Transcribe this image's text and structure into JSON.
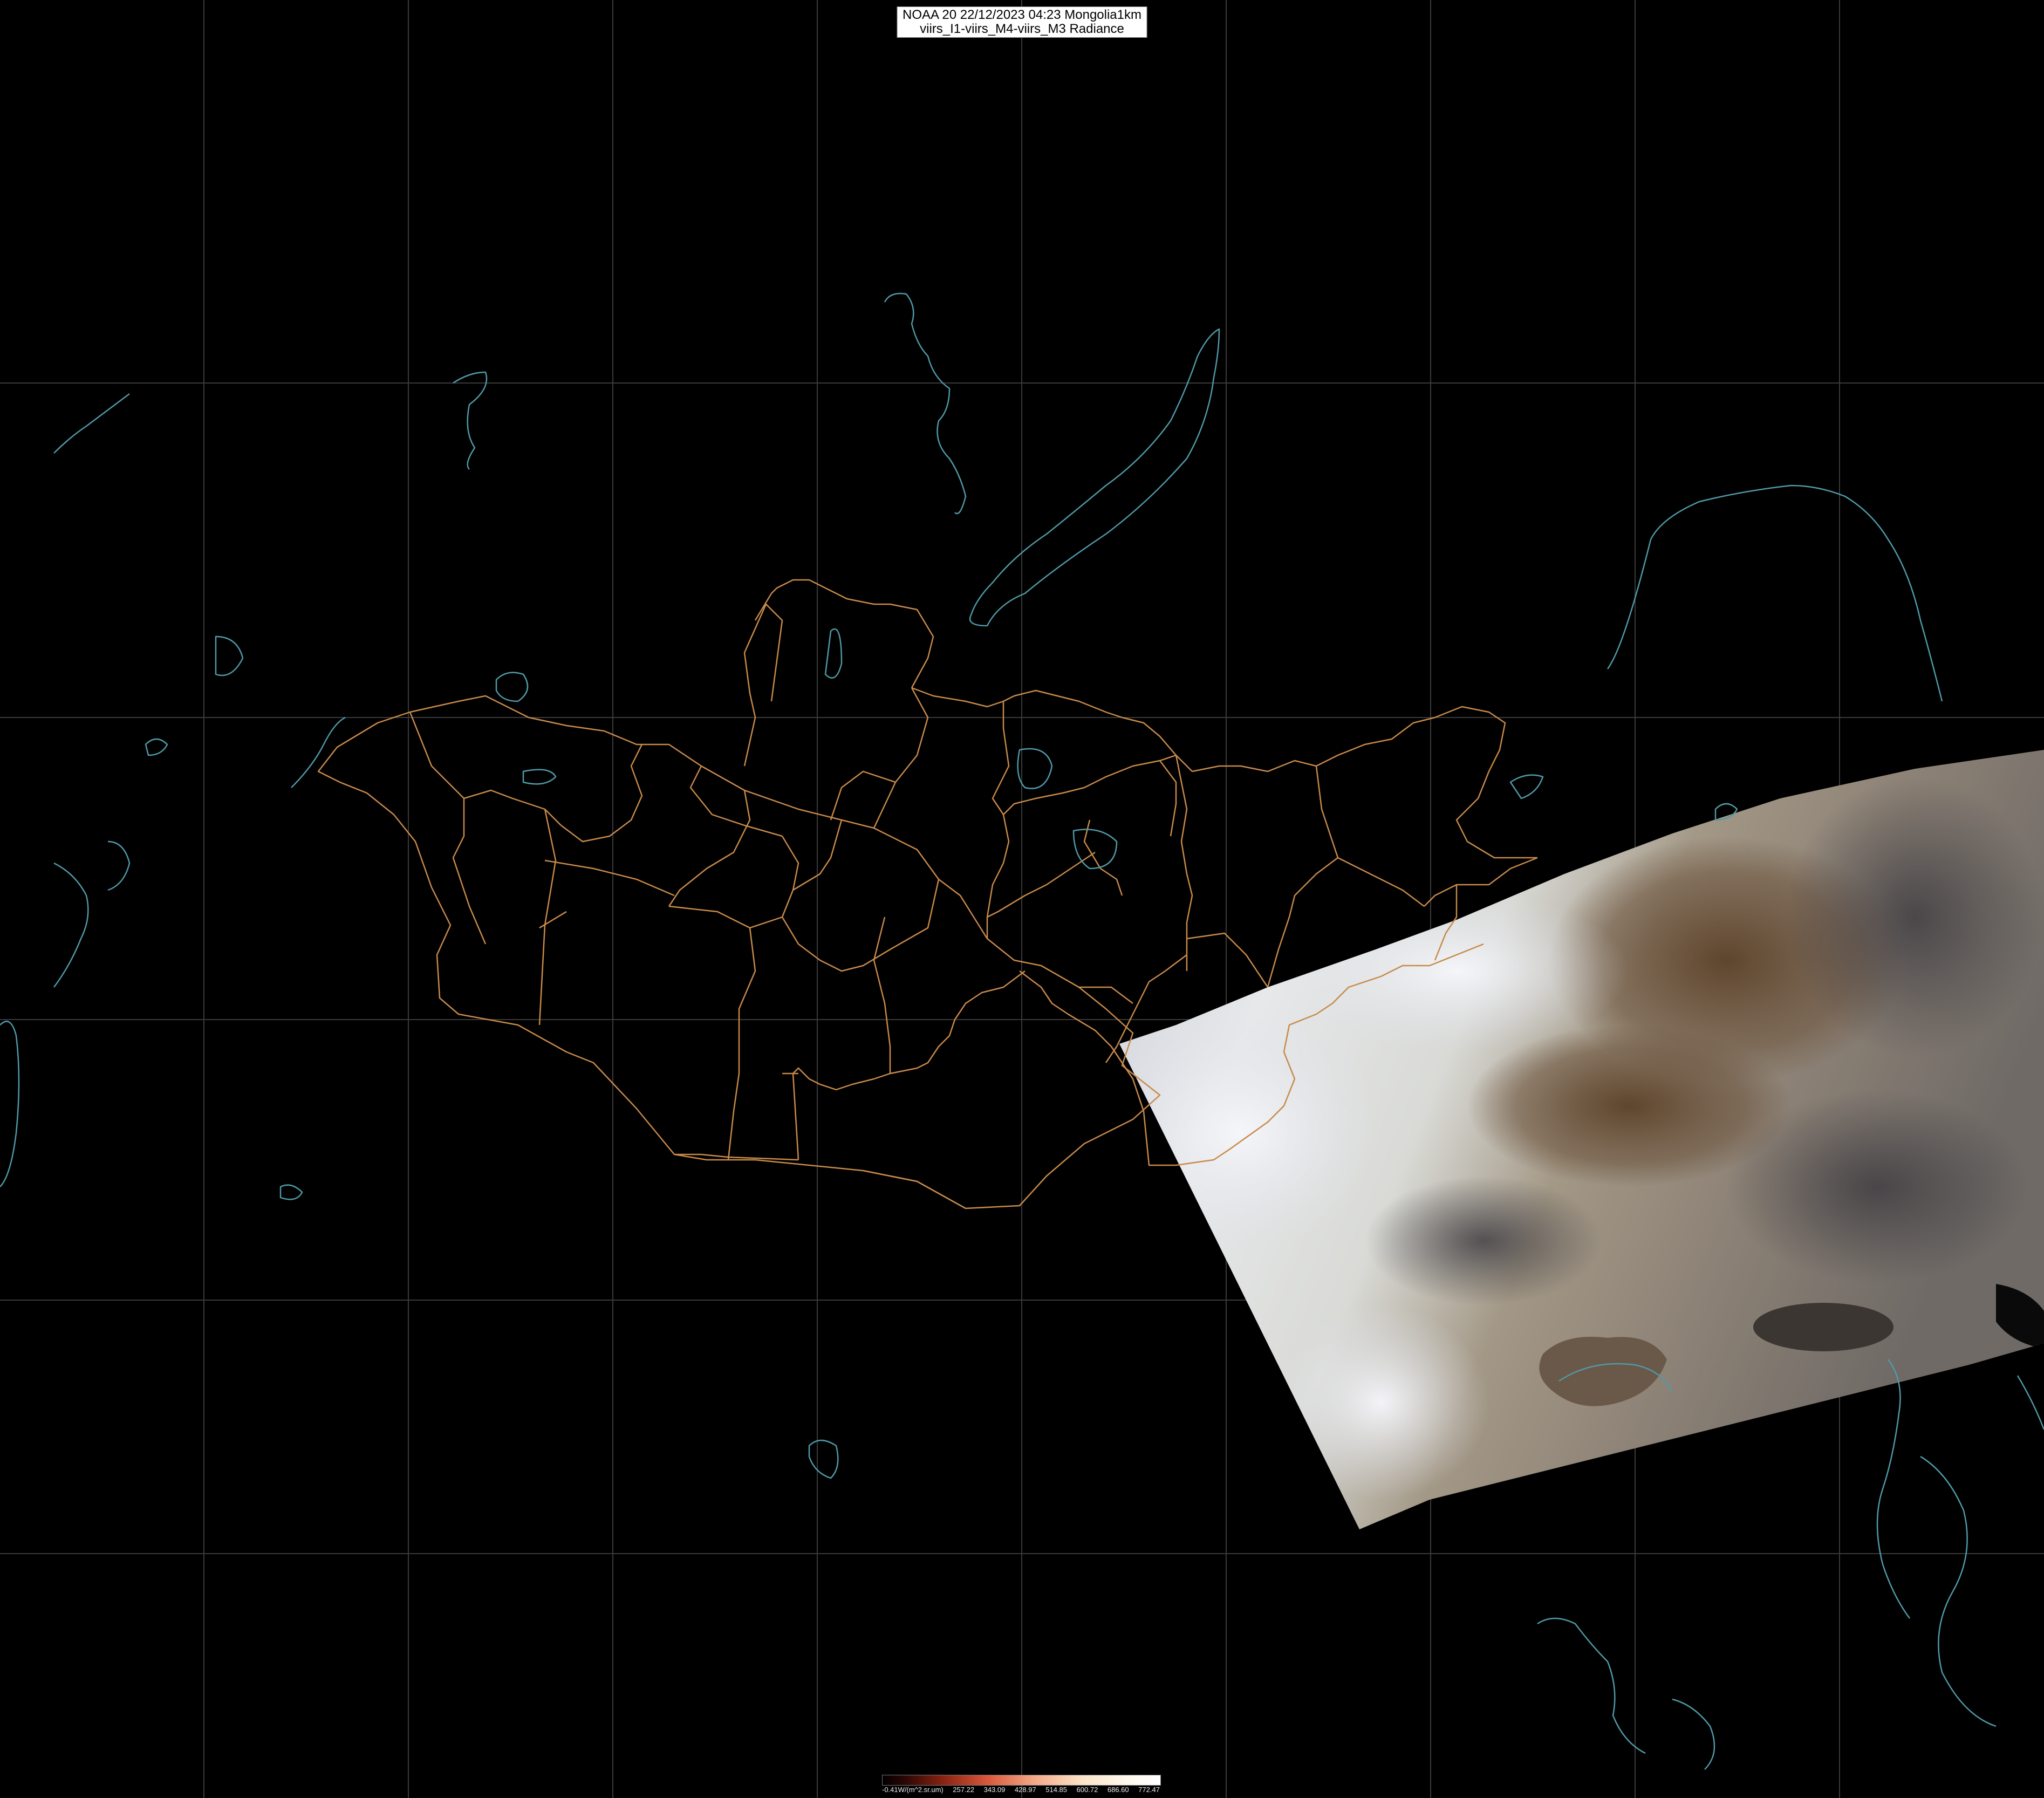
{
  "title": {
    "line1": "NOAA 20 22/12/2023 04:23 Mongolia1km",
    "line2": "viirs_I1-viirs_M4-viirs_M3 Radiance"
  },
  "legend": {
    "ticks": [
      "-0.41W/(m^2.sr.um)",
      "257.22",
      "343.09",
      "428.97",
      "514.85",
      "600.72",
      "686.60",
      "772.47"
    ]
  },
  "colors": {
    "background": "#000000",
    "grid": "#3a3a3a",
    "admin_border": "#c98a4a",
    "coast_water": "#4f9aa8"
  }
}
